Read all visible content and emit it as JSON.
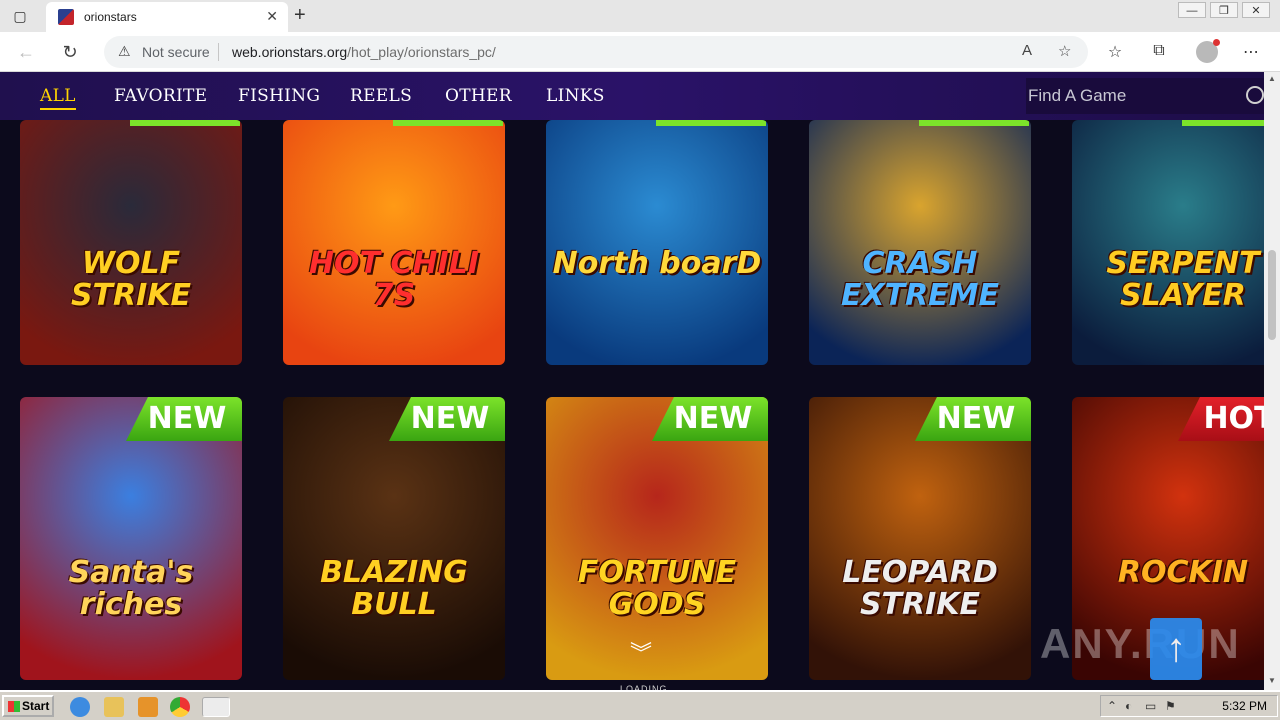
{
  "browser": {
    "tab_title": "orionstars",
    "not_secure": "Not secure",
    "url_host": "web.orionstars.org",
    "url_path": "/hot_play/orionstars_pc/"
  },
  "site_nav": {
    "items": [
      "ALL",
      "FAVORITE",
      "FISHING",
      "REELS",
      "OTHER",
      "LINKS"
    ],
    "active": "ALL",
    "search_placeholder": "Find A Game"
  },
  "games_row1": [
    {
      "title": "WOLF STRIKE",
      "colors": [
        "#2a2a3a",
        "#7a1810"
      ],
      "text_color": "#ffcf22"
    },
    {
      "title": "HOT CHILI 7S",
      "colors": [
        "#ff9a15",
        "#e84411"
      ],
      "text_color": "#ff2e2e"
    },
    {
      "title": "North boarD",
      "colors": [
        "#2b8bd2",
        "#093a7d"
      ],
      "text_color": "#ffd83b"
    },
    {
      "title": "CRASH EXTREME",
      "colors": [
        "#d9a42e",
        "#0b2457"
      ],
      "text_color": "#4fb4ff"
    },
    {
      "title": "SERPENT SLAYER",
      "colors": [
        "#2a7d8a",
        "#0b1c3c"
      ],
      "text_color": "#ffcc22"
    }
  ],
  "games_row2": [
    {
      "title": "Santa's riches",
      "badge": "NEW",
      "colors": [
        "#3b7fe0",
        "#a0141c"
      ],
      "text_color": "#ffd45a"
    },
    {
      "title": "BLAZING BULL",
      "badge": "NEW",
      "colors": [
        "#5a3214",
        "#1a0c05"
      ],
      "text_color": "#ffcf22"
    },
    {
      "title": "FORTUNE GODS",
      "badge": "NEW",
      "colors": [
        "#b6261b",
        "#d99b12"
      ],
      "text_color": "#ffd422"
    },
    {
      "title": "LEOPARD STRIKE",
      "badge": "NEW",
      "colors": [
        "#c0620f",
        "#321207"
      ],
      "text_color": "#eeeeee"
    },
    {
      "title": "ROCKIN",
      "badge": "HOT",
      "colors": [
        "#d2320e",
        "#3a0503"
      ],
      "text_color": "#ffb322"
    }
  ],
  "loading": "LOADING",
  "watermark": "ANY.RUN",
  "taskbar": {
    "start": "Start",
    "clock": "5:32 PM"
  }
}
